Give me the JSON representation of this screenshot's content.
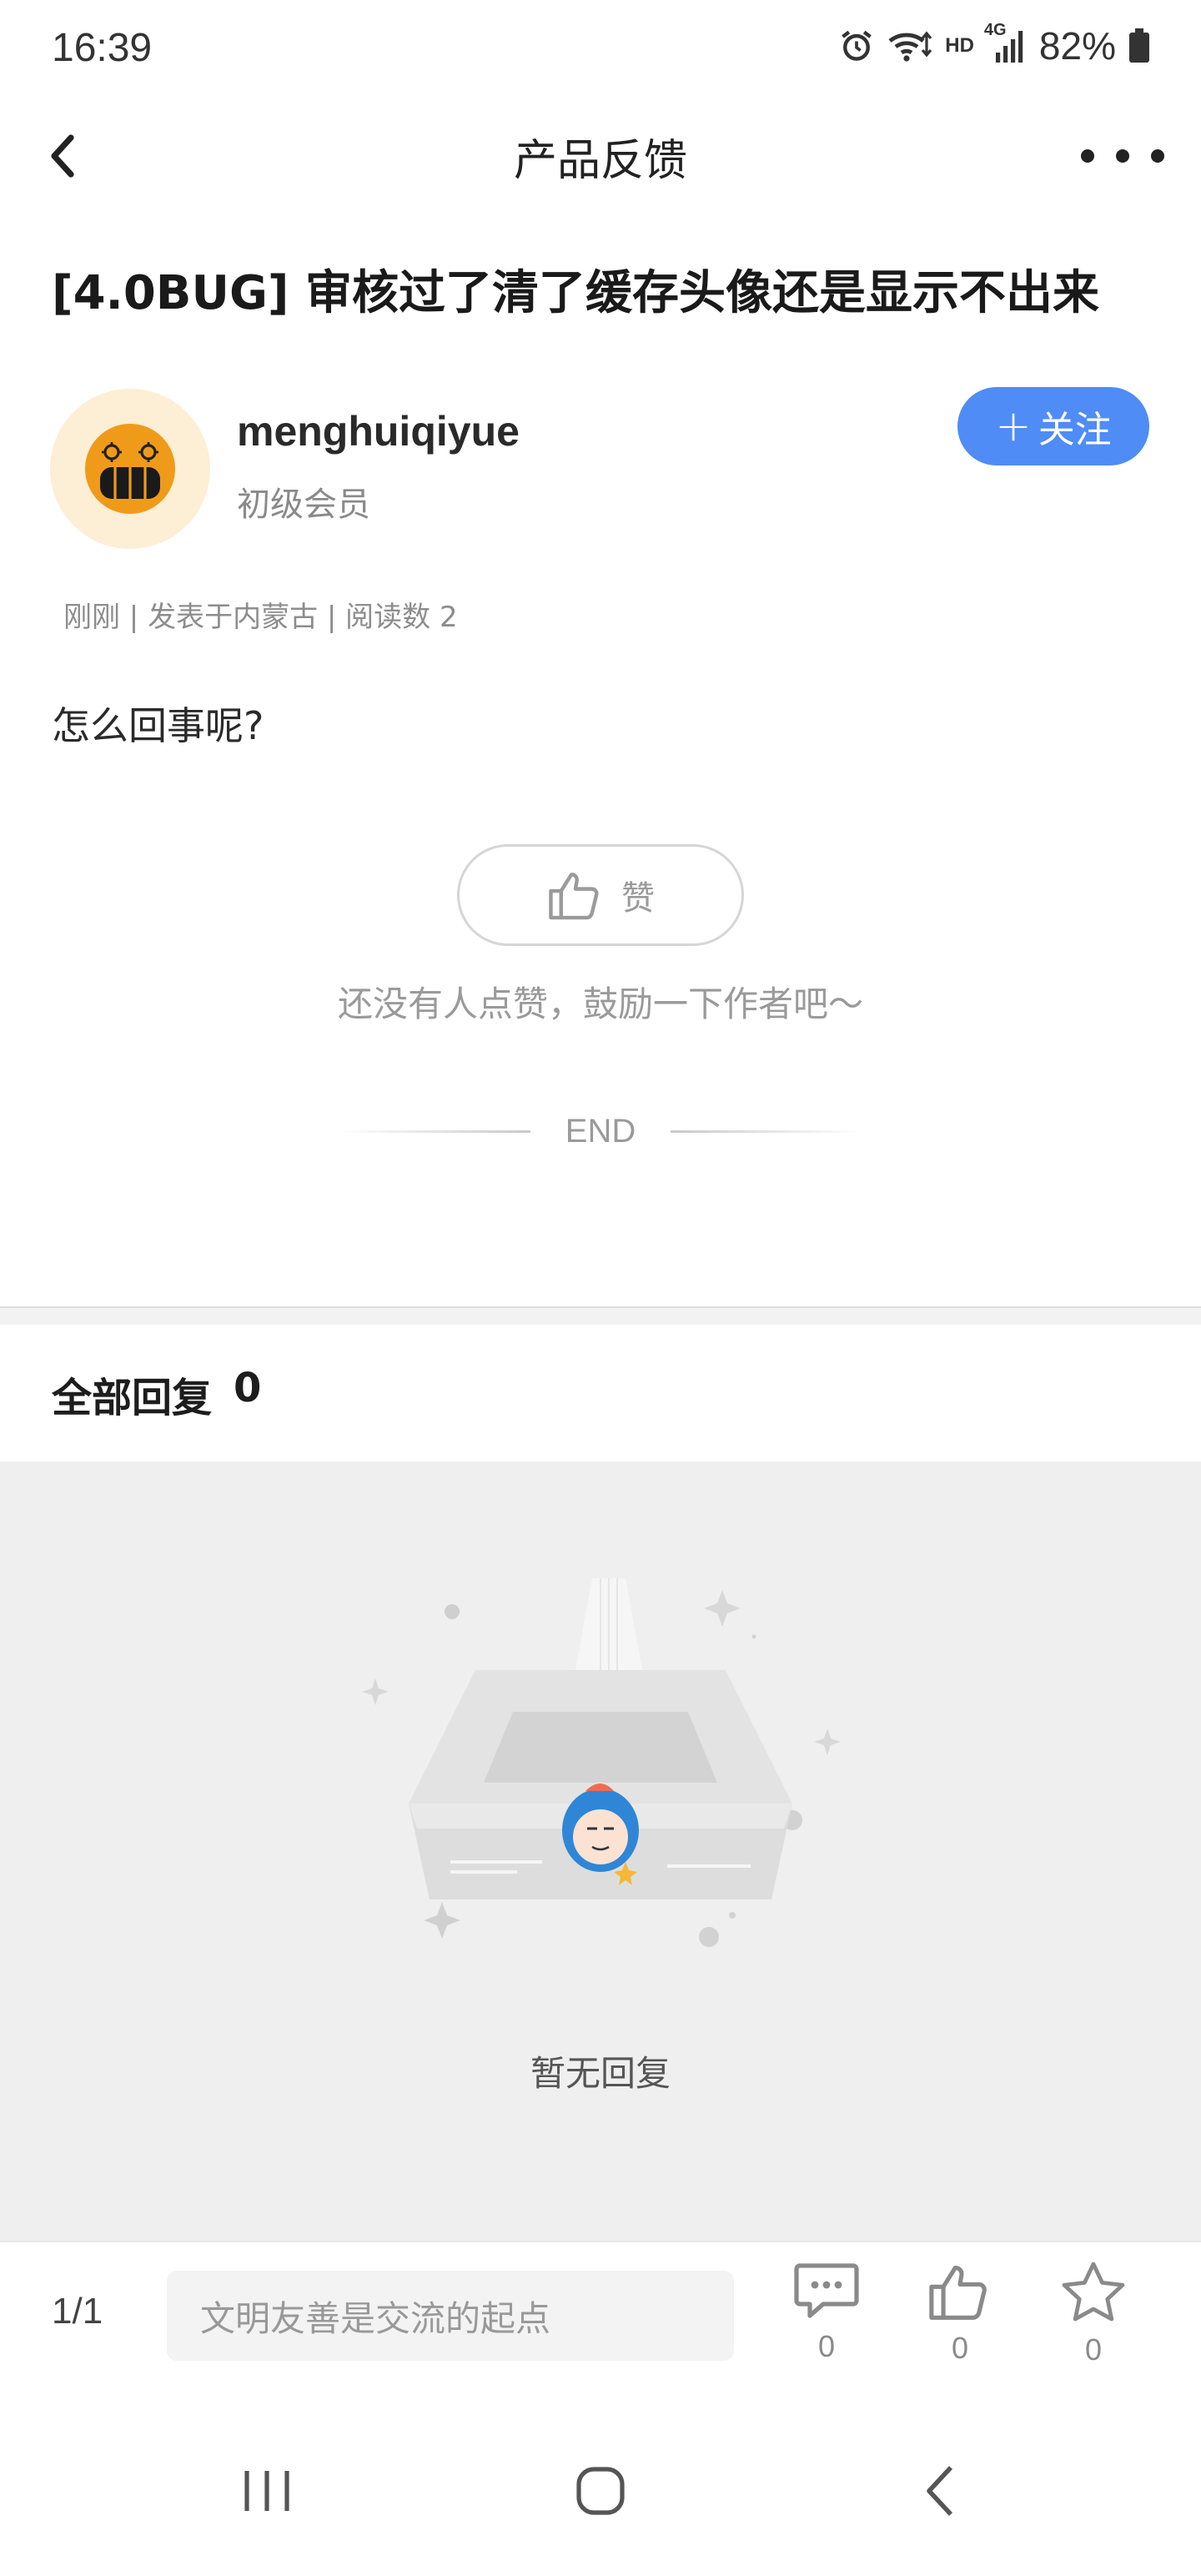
{
  "status_bar": {
    "time": "16:39",
    "hd": "HD",
    "network": "4G",
    "battery": "82%",
    "icons": [
      "alarm-icon",
      "wifi-icon",
      "signal-icon",
      "battery-icon"
    ]
  },
  "nav": {
    "title": "产品反馈",
    "back_icon": "chevron-left-icon",
    "more_icon": "more-dots-icon"
  },
  "post": {
    "title": "[4.0BUG] 审核过了清了缓存头像还是显示不出来",
    "author": {
      "name": "menghuiqiyue",
      "level": "初级会员"
    },
    "follow_label": "关注",
    "follow_plus": "+",
    "meta": "刚刚 | 发表于内蒙古 | 阅读数 2",
    "body": "怎么回事呢?",
    "like_label": "赞",
    "like_hint": "还没有人点赞，鼓励一下作者吧～",
    "end_label": "END"
  },
  "replies": {
    "header_label": "全部回复",
    "count": "0",
    "empty_text": "暂无回复"
  },
  "bottom_bar": {
    "page_indicator": "1/1",
    "input_placeholder": "文明友善是交流的起点",
    "comment_count": "0",
    "like_count": "0",
    "favorite_count": "0"
  },
  "colors": {
    "accent": "#4f8cf6",
    "avatar_bg": "#fdeed6",
    "avatar_icon": "#f09a1a",
    "empty_bg": "#efefef"
  }
}
